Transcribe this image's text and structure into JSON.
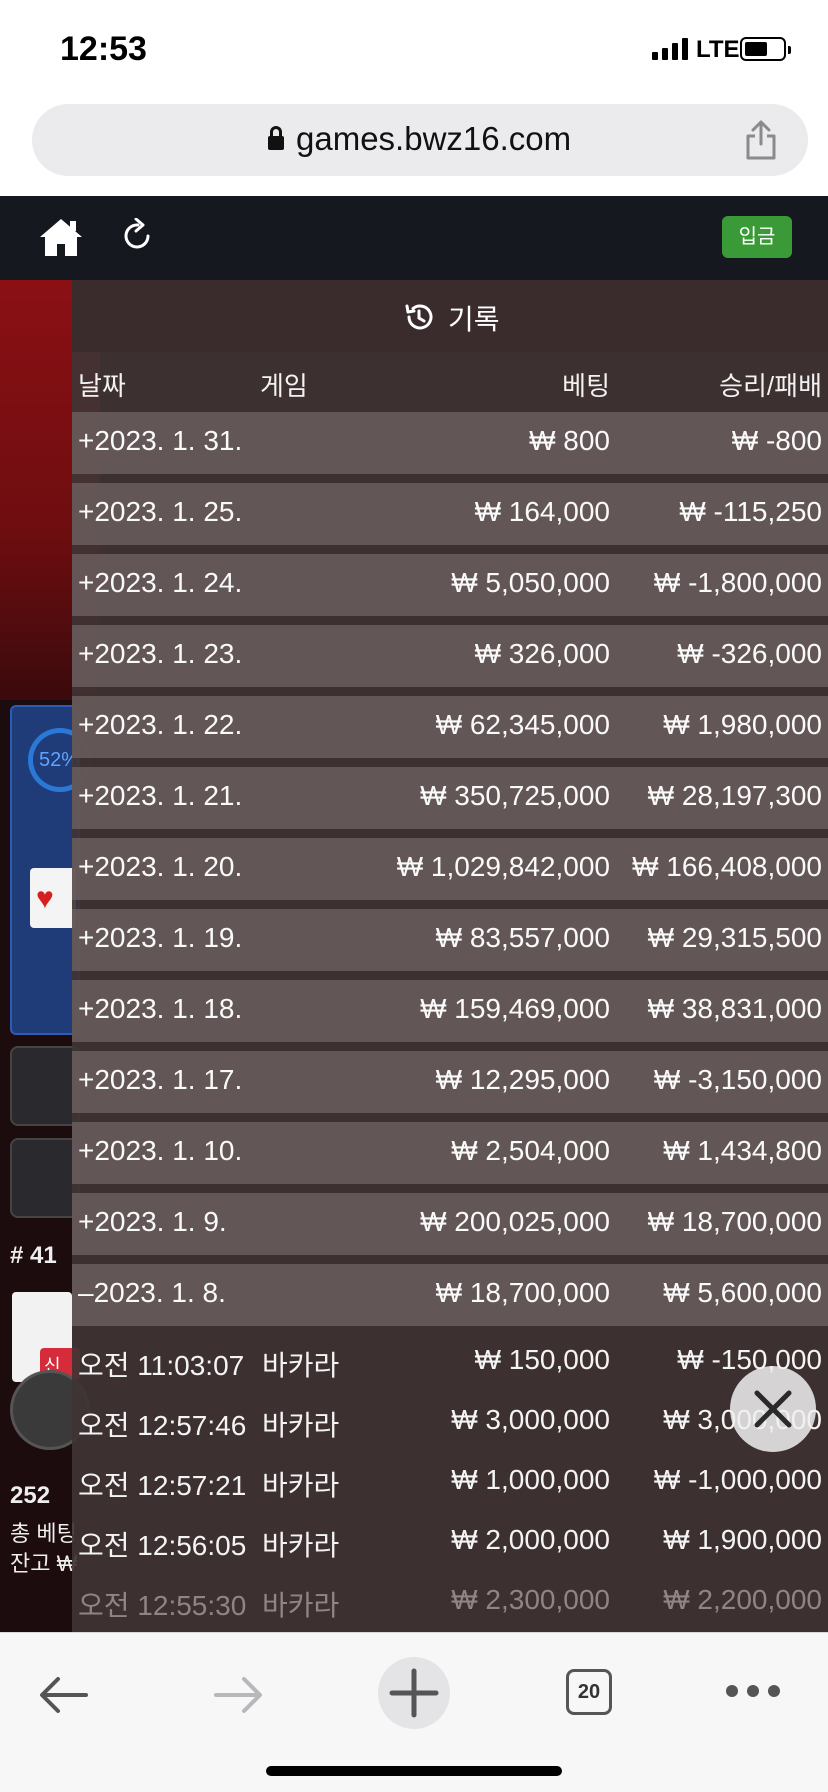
{
  "status": {
    "time": "12:53",
    "network": "LTE"
  },
  "browser": {
    "url": "games.bwz16.com",
    "tab_count": "20"
  },
  "game_nav": {
    "deposit_label": "입금"
  },
  "background": {
    "percent": "52%",
    "round": "# 41",
    "new_badge": "신규",
    "count": "252",
    "total_bet_label": "총 베팅",
    "balance_label": "잔고 ₩"
  },
  "history": {
    "title": "기록",
    "columns": {
      "date": "날짜",
      "game": "게임",
      "bet": "베팅",
      "result": "승리/패배"
    },
    "days": [
      {
        "date": "+2023. 1. 31.",
        "bet": "₩ 800",
        "result": "₩ -800"
      },
      {
        "date": "+2023. 1. 25.",
        "bet": "₩ 164,000",
        "result": "₩ -115,250"
      },
      {
        "date": "+2023. 1. 24.",
        "bet": "₩ 5,050,000",
        "result": "₩ -1,800,000"
      },
      {
        "date": "+2023. 1. 23.",
        "bet": "₩ 326,000",
        "result": "₩ -326,000"
      },
      {
        "date": "+2023. 1. 22.",
        "bet": "₩ 62,345,000",
        "result": "₩ 1,980,000"
      },
      {
        "date": "+2023. 1. 21.",
        "bet": "₩ 350,725,000",
        "result": "₩ 28,197,300"
      },
      {
        "date": "+2023. 1. 20.",
        "bet": "₩ 1,029,842,000",
        "result": "₩ 166,408,000"
      },
      {
        "date": "+2023. 1. 19.",
        "bet": "₩ 83,557,000",
        "result": "₩ 29,315,500"
      },
      {
        "date": "+2023. 1. 18.",
        "bet": "₩ 159,469,000",
        "result": "₩ 38,831,000"
      },
      {
        "date": "+2023. 1. 17.",
        "bet": "₩ 12,295,000",
        "result": "₩ -3,150,000"
      },
      {
        "date": "+2023. 1. 10.",
        "bet": "₩ 2,504,000",
        "result": "₩ 1,434,800"
      },
      {
        "date": "+2023. 1. 9.",
        "bet": "₩ 200,025,000",
        "result": "₩ 18,700,000"
      },
      {
        "date": "–2023. 1. 8.",
        "bet": "₩ 18,700,000",
        "result": "₩ 5,600,000"
      }
    ],
    "entries": [
      {
        "time": "오전 11:03:07",
        "game": "바카라",
        "bet": "₩ 150,000",
        "result": "₩ -150,000"
      },
      {
        "time": "오전 12:57:46",
        "game": "바카라",
        "bet": "₩ 3,000,000",
        "result": "₩ 3,000,000"
      },
      {
        "time": "오전 12:57:21",
        "game": "바카라",
        "bet": "₩ 1,000,000",
        "result": "₩ -1,000,000"
      },
      {
        "time": "오전 12:56:05",
        "game": "바카라",
        "bet": "₩ 2,000,000",
        "result": "₩ 1,900,000"
      },
      {
        "time": "오전 12:55:30",
        "game": "바카라",
        "bet": "₩ 2,300,000",
        "result": "₩ 2,200,000"
      }
    ]
  },
  "icons": [
    "lock-icon",
    "share-icon",
    "home-icon",
    "refresh-icon",
    "history-icon",
    "close-icon",
    "back-arrow-icon",
    "forward-arrow-icon",
    "plus-icon",
    "more-icon"
  ]
}
